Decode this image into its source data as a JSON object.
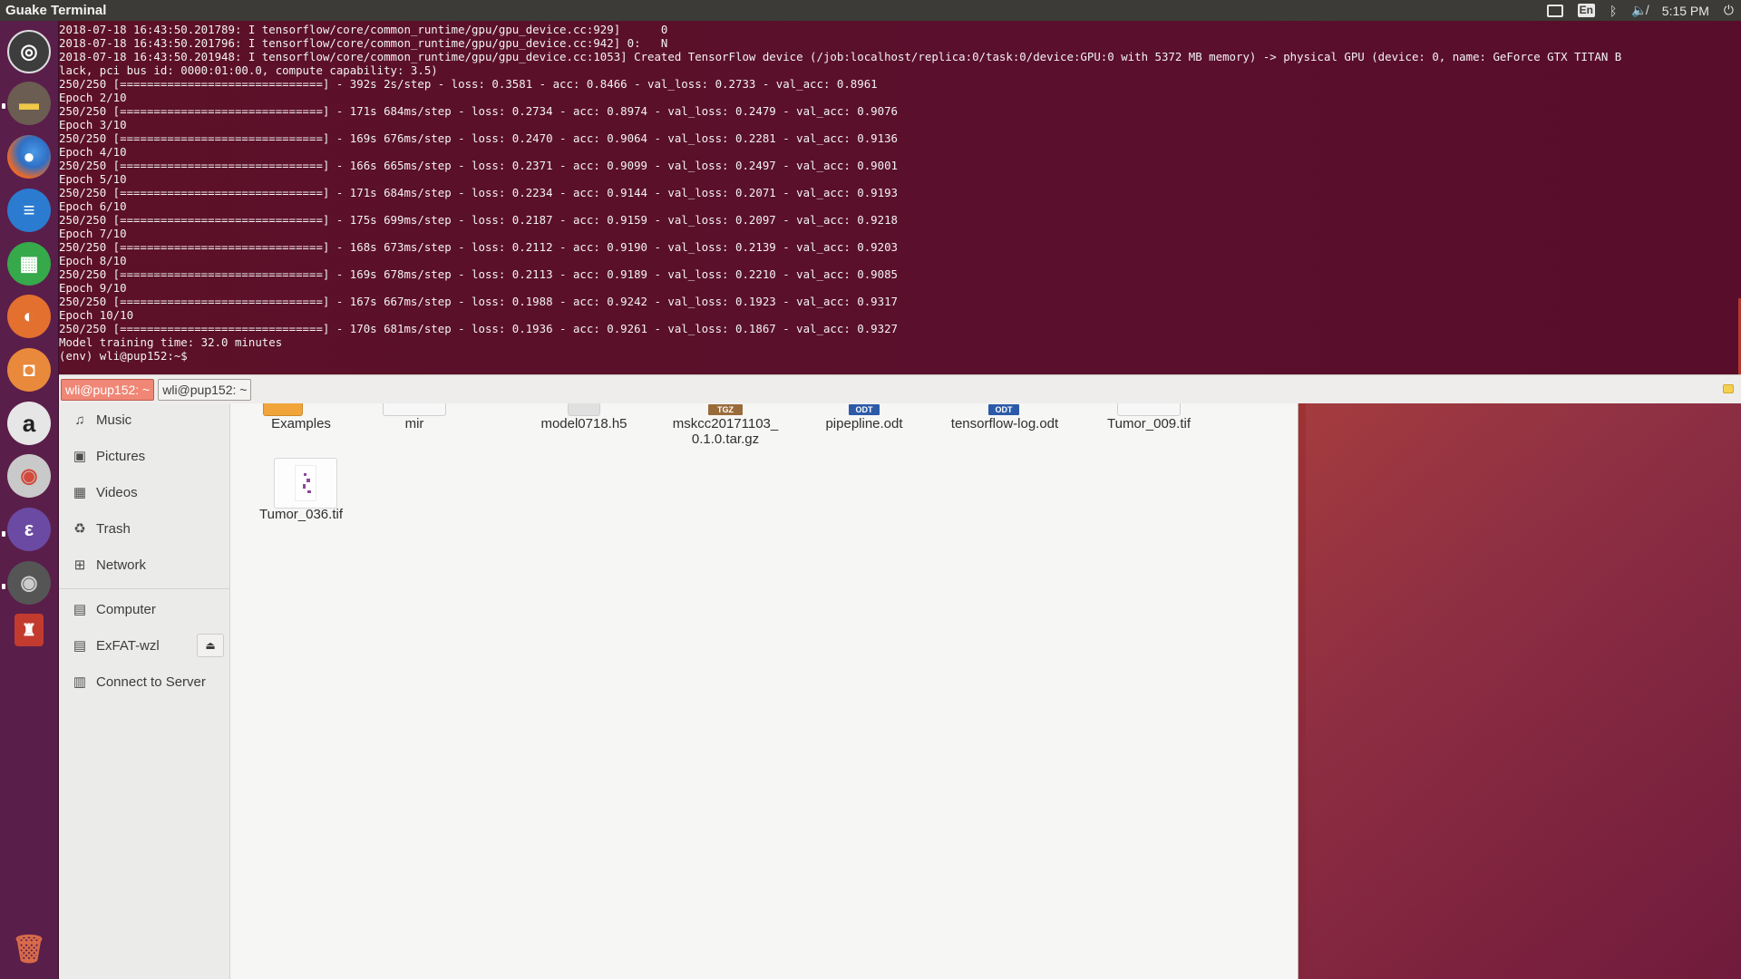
{
  "top_panel": {
    "app_title": "Guake Terminal",
    "lang": "En",
    "clock": "5:15 PM",
    "icons": [
      "display-icon",
      "keyboard-lang-icon",
      "bluetooth-icon",
      "volume-muted-icon",
      "power-icon"
    ]
  },
  "launcher": {
    "items": [
      {
        "name": "ubuntu-dash-icon",
        "color": "#3b3b3b",
        "glyph": "◎"
      },
      {
        "name": "files-icon",
        "color": "#6a5a4a",
        "glyph": "▬"
      },
      {
        "name": "firefox-icon",
        "color": "#d9612b",
        "glyph": "●"
      },
      {
        "name": "libreoffice-writer-icon",
        "color": "#2c79c8",
        "glyph": "≡"
      },
      {
        "name": "libreoffice-calc-icon",
        "color": "#35a84a",
        "glyph": "▦"
      },
      {
        "name": "libreoffice-impress-icon",
        "color": "#e06a2b",
        "glyph": "◐"
      },
      {
        "name": "ubuntu-software-icon",
        "color": "#e8743b",
        "glyph": "◘"
      },
      {
        "name": "amazon-icon",
        "color": "#dcdcdc",
        "glyph": "a"
      },
      {
        "name": "settings-icon",
        "color": "#b5b5b5",
        "glyph": "◉"
      },
      {
        "name": "emacs-icon",
        "color": "#6d4d9a",
        "glyph": "ε"
      },
      {
        "name": "webcam-icon",
        "color": "#4a4a4a",
        "glyph": "◉"
      },
      {
        "name": "guake-icon",
        "color": "#c43a2e",
        "glyph": "♜"
      }
    ],
    "trash_icon": "trash-icon"
  },
  "terminal": {
    "lines": [
      "2018-07-18 16:43:50.201789: I tensorflow/core/common_runtime/gpu/gpu_device.cc:929]      0",
      "2018-07-18 16:43:50.201796: I tensorflow/core/common_runtime/gpu/gpu_device.cc:942] 0:   N",
      "2018-07-18 16:43:50.201948: I tensorflow/core/common_runtime/gpu/gpu_device.cc:1053] Created TensorFlow device (/job:localhost/replica:0/task:0/device:GPU:0 with 5372 MB memory) -> physical GPU (device: 0, name: GeForce GTX TITAN B",
      "lack, pci bus id: 0000:01:00.0, compute capability: 3.5)",
      "250/250 [==============================] - 392s 2s/step - loss: 0.3581 - acc: 0.8466 - val_loss: 0.2733 - val_acc: 0.8961",
      "Epoch 2/10",
      "250/250 [==============================] - 171s 684ms/step - loss: 0.2734 - acc: 0.8974 - val_loss: 0.2479 - val_acc: 0.9076",
      "Epoch 3/10",
      "250/250 [==============================] - 169s 676ms/step - loss: 0.2470 - acc: 0.9064 - val_loss: 0.2281 - val_acc: 0.9136",
      "Epoch 4/10",
      "250/250 [==============================] - 166s 665ms/step - loss: 0.2371 - acc: 0.9099 - val_loss: 0.2497 - val_acc: 0.9001",
      "Epoch 5/10",
      "250/250 [==============================] - 171s 684ms/step - loss: 0.2234 - acc: 0.9144 - val_loss: 0.2071 - val_acc: 0.9193",
      "Epoch 6/10",
      "250/250 [==============================] - 175s 699ms/step - loss: 0.2187 - acc: 0.9159 - val_loss: 0.2097 - val_acc: 0.9218",
      "Epoch 7/10",
      "250/250 [==============================] - 168s 673ms/step - loss: 0.2112 - acc: 0.9190 - val_loss: 0.2139 - val_acc: 0.9203",
      "Epoch 8/10",
      "250/250 [==============================] - 169s 678ms/step - loss: 0.2113 - acc: 0.9189 - val_loss: 0.2210 - val_acc: 0.9085",
      "Epoch 9/10",
      "250/250 [==============================] - 167s 667ms/step - loss: 0.1988 - acc: 0.9242 - val_loss: 0.1923 - val_acc: 0.9317",
      "Epoch 10/10",
      "250/250 [==============================] - 170s 681ms/step - loss: 0.1936 - acc: 0.9261 - val_loss: 0.1867 - val_acc: 0.9327",
      "Model training time: 32.0 minutes",
      "(env) wli@pup152:~$ "
    ]
  },
  "tabs": [
    {
      "label": "wli@pup152: ~",
      "active": true
    },
    {
      "label": "wli@pup152: ~",
      "active": false
    }
  ],
  "sidebar": {
    "items": [
      {
        "label": "Music",
        "icon": "music-icon",
        "glyph": "♫"
      },
      {
        "label": "Pictures",
        "icon": "pictures-icon",
        "glyph": "▣"
      },
      {
        "label": "Videos",
        "icon": "videos-icon",
        "glyph": "▦"
      },
      {
        "label": "Trash",
        "icon": "trash-icon",
        "glyph": "🗑"
      },
      {
        "label": "Network",
        "icon": "network-icon",
        "glyph": "⊞"
      },
      {
        "label": "Computer",
        "icon": "computer-icon",
        "glyph": "▤"
      },
      {
        "label": "ExFAT-wzl",
        "icon": "drive-icon",
        "glyph": "▤"
      },
      {
        "label": "Connect to Server",
        "icon": "server-icon",
        "glyph": "▥"
      }
    ],
    "eject_icon": "eject-icon"
  },
  "files": [
    {
      "name": "Examples",
      "type": "folder"
    },
    {
      "name": "mir",
      "type": "file"
    },
    {
      "name": "model0718.h5",
      "type": "file"
    },
    {
      "name": "mskcc20171103_0.1.0.tar.gz",
      "line1": "mskcc20171103_",
      "line2": "0.1.0.tar.gz",
      "badge": "TGZ",
      "badge_color": "#9a6b3a"
    },
    {
      "name": "pipepline.odt",
      "badge": "ODT",
      "badge_color": "#2c5aa8"
    },
    {
      "name": "tensorflow-log.odt",
      "badge": "ODT",
      "badge_color": "#2c5aa8"
    },
    {
      "name": "Tumor_009.tif",
      "type": "image"
    },
    {
      "name": "Tumor_036.tif",
      "type": "image"
    }
  ]
}
